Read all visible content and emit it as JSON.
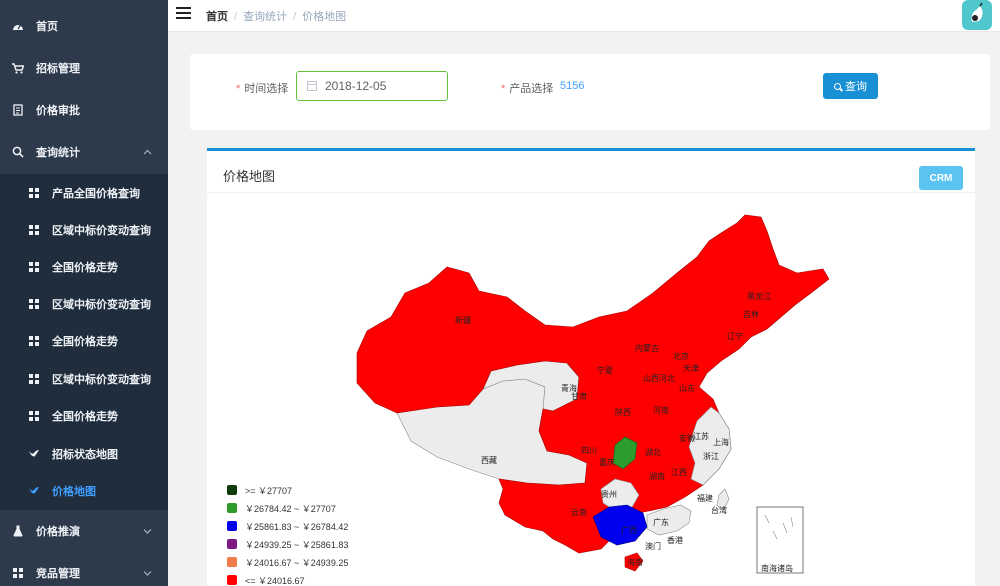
{
  "sidebar": {
    "items": [
      {
        "label": "首页",
        "icon": "dashboard-icon"
      },
      {
        "label": "招标管理",
        "icon": "cart-icon"
      },
      {
        "label": "价格审批",
        "icon": "document-icon"
      },
      {
        "label": "查询统计",
        "icon": "search-icon",
        "expanded": true
      }
    ],
    "sub_items": [
      {
        "label": "产品全国价格查询"
      },
      {
        "label": "区域中标价变动查询"
      },
      {
        "label": "全国价格走势"
      },
      {
        "label": "区域中标价变动查询"
      },
      {
        "label": "全国价格走势"
      },
      {
        "label": "区域中标价变动查询"
      },
      {
        "label": "全国价格走势"
      },
      {
        "label": "招标状态地图"
      },
      {
        "label": "价格地图",
        "active": true
      }
    ],
    "bottom_items": [
      {
        "label": "价格推演",
        "icon": "flask-icon"
      },
      {
        "label": "竞品管理",
        "icon": "grid-icon"
      }
    ]
  },
  "breadcrumb": {
    "home": "首页",
    "section": "查询统计",
    "page": "价格地图"
  },
  "form": {
    "date_label": "时间选择",
    "date_value": "2018-12-05",
    "product_label": "产品选择",
    "product_value": "5156",
    "query_button": "查询"
  },
  "map_card": {
    "title": "价格地图",
    "crm_button": "CRM",
    "legend": [
      {
        "label": ">= ￥27707",
        "color": "#0b3d0b"
      },
      {
        "label": "￥26784.42 ~ ￥27707",
        "color": "#2e9b2e"
      },
      {
        "label": "￥25861.83 ~ ￥26784.42",
        "color": "#0000ee"
      },
      {
        "label": "￥24939.25 ~ ￥25861.83",
        "color": "#7b1a85"
      },
      {
        "label": "￥24016.67 ~ ￥24939.25",
        "color": "#f07a4a"
      },
      {
        "label": "<= ￥24016.67",
        "color": "#ff0000"
      }
    ],
    "provinces": {
      "xinjiang": "新疆",
      "xizang": "西藏",
      "qinghai": "青海",
      "gansu": "甘肃",
      "neimenggu": "内蒙古",
      "heilongjiang": "黑龙江",
      "jilin": "吉林",
      "liaoning": "辽宁",
      "beijing": "北京",
      "tianjin": "天津",
      "hebei": "河北",
      "shanxi": "山西",
      "shandong": "山东",
      "ningxia": "宁夏",
      "shaanxi": "陕西",
      "henan": "河南",
      "anhui": "安徽",
      "jiangsu": "江苏",
      "shanghai": "上海",
      "sichuan": "四川",
      "chongqing": "重庆",
      "hubei": "湖北",
      "zhejiang": "浙江",
      "hunan": "湖南",
      "jiangxi": "江西",
      "guizhou": "贵州",
      "yunnan": "云南",
      "fujian": "福建",
      "taiwan": "台湾",
      "guangxi": "广西",
      "guangdong": "广东",
      "hongkong": "香港",
      "macau": "澳门",
      "hainan": "海南",
      "southsea": "南海诸岛"
    }
  }
}
